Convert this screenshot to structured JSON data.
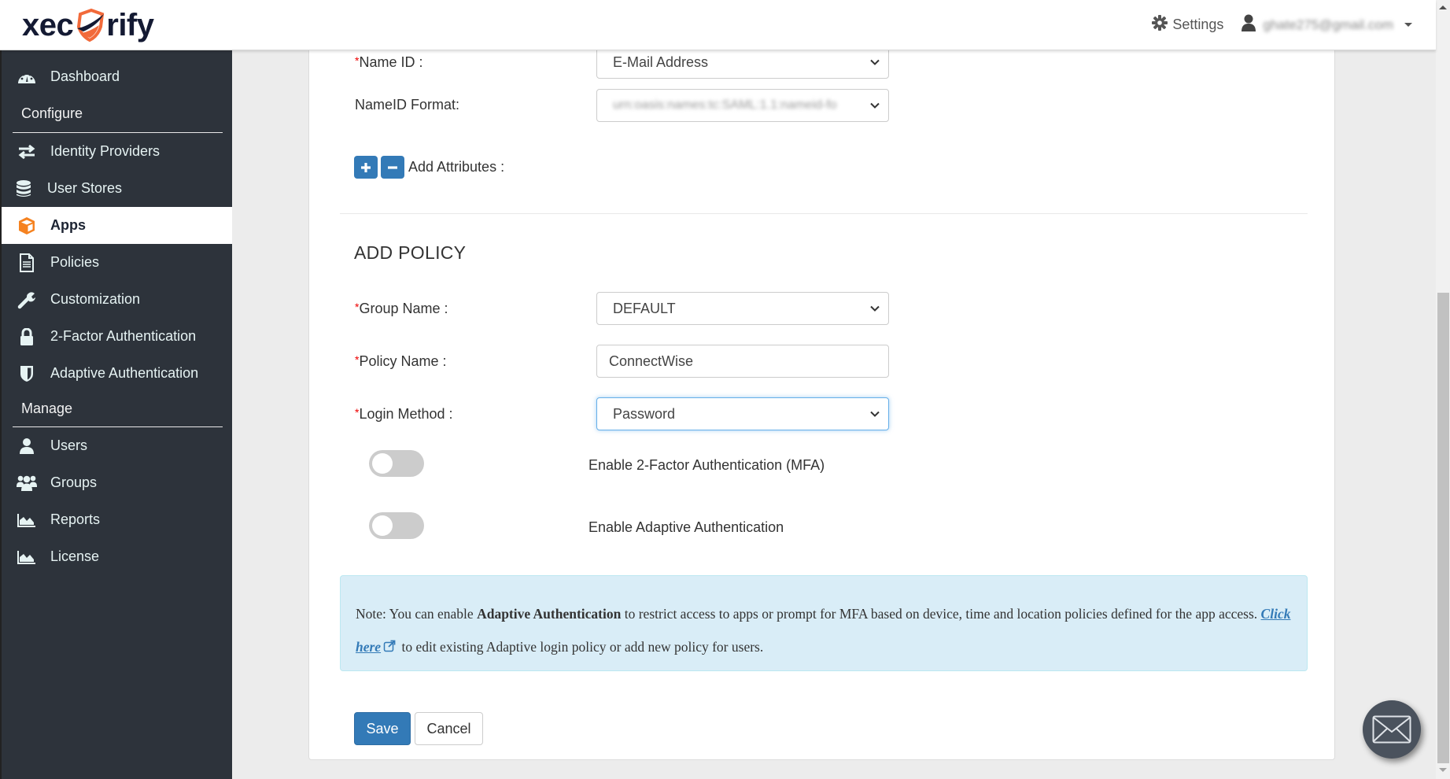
{
  "header": {
    "logo_text_left": "xec",
    "logo_text_right": "rify",
    "settings_label": "Settings",
    "user_email": "ghate275@gmail.com"
  },
  "sidebar": {
    "items": [
      {
        "label": "Dashboard",
        "icon": "dashboard-icon"
      },
      {
        "label": "Identity Providers",
        "icon": "exchange-icon"
      },
      {
        "label": "User Stores",
        "icon": "database-icon"
      },
      {
        "label": "Apps",
        "icon": "cube-icon",
        "active": true
      },
      {
        "label": "Policies",
        "icon": "document-icon"
      },
      {
        "label": "Customization",
        "icon": "wrench-icon"
      },
      {
        "label": "2-Factor Authentication",
        "icon": "lock-icon"
      },
      {
        "label": "Adaptive Authentication",
        "icon": "shield-icon"
      },
      {
        "label": "Users",
        "icon": "user-icon"
      },
      {
        "label": "Groups",
        "icon": "users-icon"
      },
      {
        "label": "Reports",
        "icon": "area-chart-icon"
      },
      {
        "label": "License",
        "icon": "area-chart-icon"
      }
    ],
    "sections": {
      "configure": "Configure",
      "manage": "Manage"
    }
  },
  "form": {
    "name_id": {
      "label": "Name ID :",
      "value": "E-Mail Address"
    },
    "nameid_format": {
      "label": "NameID Format:",
      "value": "urn:oasis:names:tc:SAML:1.1:nameid-fo"
    },
    "add_attributes_label": "Add Attributes :",
    "policy_heading": "ADD POLICY",
    "group_name": {
      "label": "Group Name :",
      "value": "DEFAULT"
    },
    "policy_name": {
      "label": "Policy Name :",
      "value": "ConnectWise"
    },
    "login_method": {
      "label": "Login Method :",
      "value": "Password"
    },
    "toggle_mfa": {
      "label": "Enable 2-Factor Authentication (MFA)",
      "on": false
    },
    "toggle_adaptive": {
      "label": "Enable Adaptive Authentication",
      "on": false
    },
    "required_marker": "*"
  },
  "note": {
    "prefix": "Note: You can enable ",
    "bold": "Adaptive Authentication",
    "middle": " to restrict access to apps or prompt for MFA based on device, time and location policies defined for the app access. ",
    "link": "Click here",
    "suffix": " to edit existing Adaptive login policy or add new policy for users."
  },
  "buttons": {
    "save": "Save",
    "cancel": "Cancel"
  },
  "colors": {
    "primary": "#337ab7",
    "sidebar_bg": "#2d333b",
    "accent_orange": "#f58220",
    "note_bg": "#d9edf7"
  }
}
